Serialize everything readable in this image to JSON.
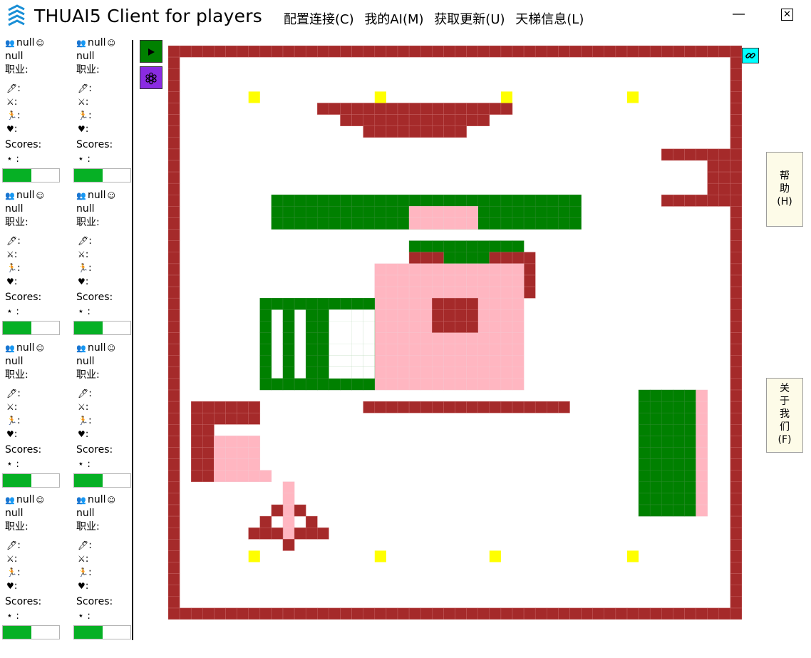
{
  "window": {
    "title": "THUAI5 Client for players",
    "minimize_glyph": "—",
    "close_glyph": "✕"
  },
  "menu": [
    {
      "label": "配置连接(C)"
    },
    {
      "label": "我的AI(M)"
    },
    {
      "label": "获取更新(U)"
    },
    {
      "label": "天梯信息(L)"
    }
  ],
  "toolbar": {
    "play_icon": "play-icon",
    "settings_icon": "settings-icon",
    "link_icon": "link-icon",
    "play_color": "#008000",
    "settings_color": "#8a2be2",
    "link_color": "#00ffff"
  },
  "side_buttons": {
    "help_lines": [
      "帮",
      "助",
      "(H)"
    ],
    "about_lines": [
      "关",
      "于",
      "我",
      "们",
      "(F)"
    ]
  },
  "player_card_template": {
    "team_label": "null",
    "name_label": "null",
    "role_label": "职业:",
    "attack_label": ":",
    "shield_label": ":",
    "speed_label": ":",
    "hp_label": ":",
    "scores_label": "Scores:",
    "star_label": "⋆ :",
    "progress_fraction": 0.5
  },
  "players": [
    {
      "team": "null",
      "name": "null",
      "role": "职业:",
      "scores": "Scores:",
      "progress": 0.5
    },
    {
      "team": "null",
      "name": "null",
      "role": "职业:",
      "scores": "Scores:",
      "progress": 0.5
    },
    {
      "team": "null",
      "name": "null",
      "role": "职业:",
      "scores": "Scores:",
      "progress": 0.5
    },
    {
      "team": "null",
      "name": "null",
      "role": "职业:",
      "scores": "Scores:",
      "progress": 0.5
    },
    {
      "team": "null",
      "name": "null",
      "role": "职业:",
      "scores": "Scores:",
      "progress": 0.5
    },
    {
      "team": "null",
      "name": "null",
      "role": "职业:",
      "scores": "Scores:",
      "progress": 0.5
    },
    {
      "team": "null",
      "name": "null",
      "role": "职业:",
      "scores": "Scores:",
      "progress": 0.5
    },
    {
      "team": "null",
      "name": "null",
      "role": "职业:",
      "scores": "Scores:",
      "progress": 0.5
    }
  ],
  "map_colors": {
    "wall": "#a52a2a",
    "grass": "#008000",
    "pink_zone": "#ffb6c1",
    "item": "#ffff00",
    "ground": "#ffffff",
    "grid_line": "#c46060"
  }
}
